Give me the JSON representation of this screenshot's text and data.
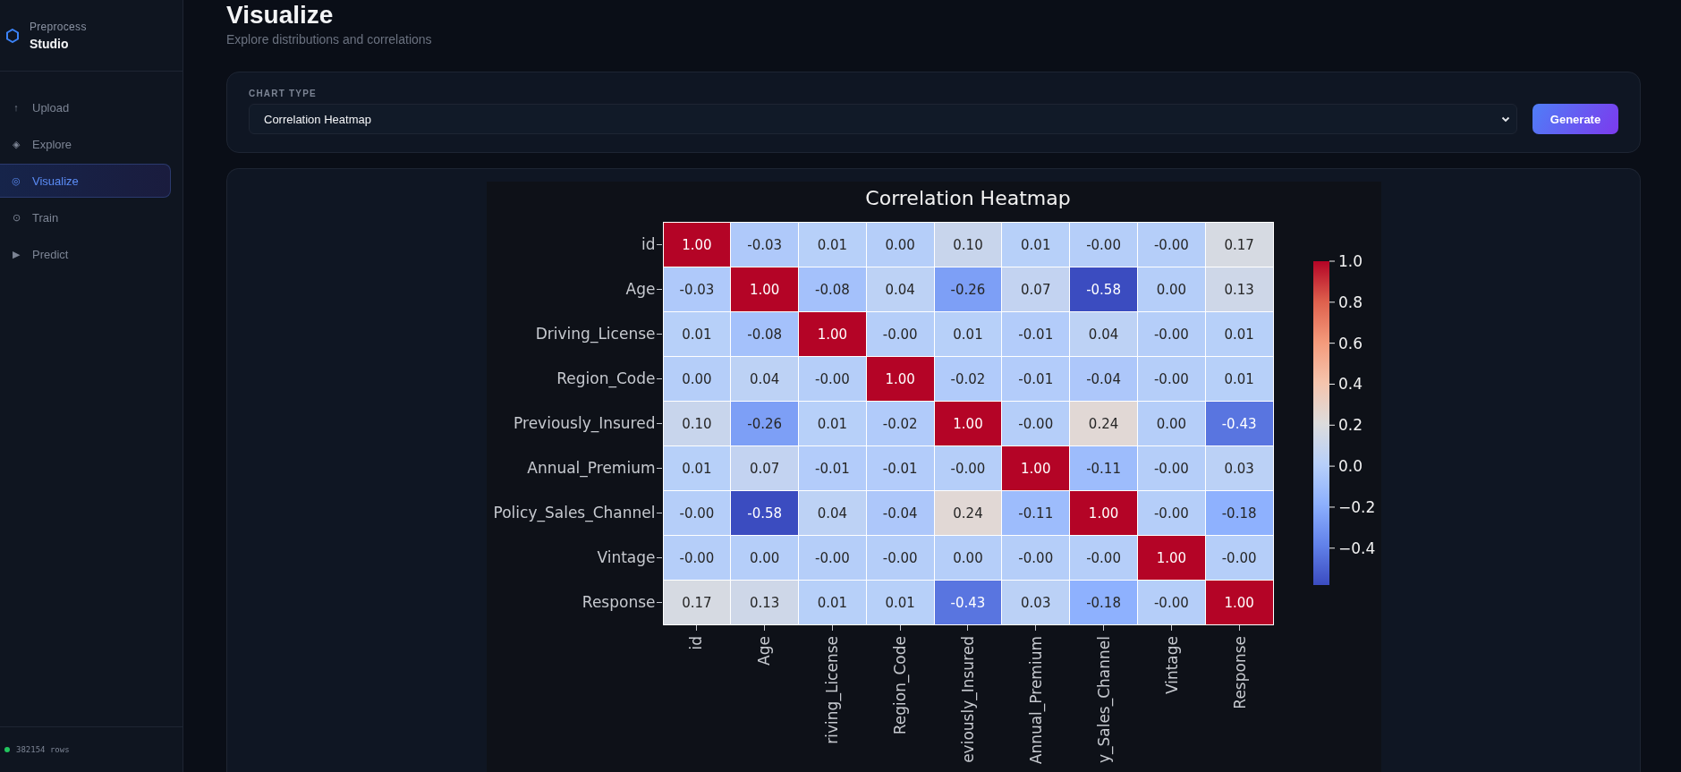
{
  "sidebar": {
    "brand": {
      "top": "Preprocess",
      "name": "Studio"
    },
    "items": [
      {
        "icon": "↑",
        "label": "Upload",
        "selected": false
      },
      {
        "icon": "◈",
        "label": "Explore",
        "selected": false
      },
      {
        "icon": "◎",
        "label": "Visualize",
        "selected": true
      },
      {
        "icon": "⊙",
        "label": "Train",
        "selected": false
      },
      {
        "icon": "▶",
        "label": "Predict",
        "selected": false
      }
    ],
    "status": {
      "text": "382154 rows",
      "color": "#22c55e"
    }
  },
  "header": {
    "title": "Visualize",
    "subtitle": "Explore distributions and correlations"
  },
  "controls": {
    "label": "CHART TYPE",
    "value": "Correlation Heatmap",
    "button": "Generate"
  },
  "heatmap": {
    "title": "Correlation Heatmap",
    "row_labels": [
      "id",
      "Age",
      "Driving_License",
      "Region_Code",
      "Previously_Insured",
      "Annual_Premium",
      "Policy_Sales_Channel",
      "Vintage",
      "Response"
    ],
    "column_labels": [
      "id",
      "Age",
      "riving_License",
      "Region_Code",
      "eviously_Insured",
      "Annual_Premium",
      "y_Sales_Channel",
      "Vintage",
      "Response"
    ],
    "rows": [
      [
        "1.00",
        "-0.03",
        "0.01",
        "0.00",
        "0.10",
        "0.01",
        "-0.00",
        "-0.00",
        "0.17"
      ],
      [
        "-0.03",
        "1.00",
        "-0.08",
        "0.04",
        "-0.26",
        "0.07",
        "-0.58",
        "0.00",
        "0.13"
      ],
      [
        "0.01",
        "-0.08",
        "1.00",
        "-0.00",
        "0.01",
        "-0.01",
        "0.04",
        "-0.00",
        "0.01"
      ],
      [
        "0.00",
        "0.04",
        "-0.00",
        "1.00",
        "-0.02",
        "-0.01",
        "-0.04",
        "-0.00",
        "0.01"
      ],
      [
        "0.10",
        "-0.26",
        "0.01",
        "-0.02",
        "1.00",
        "-0.00",
        "0.24",
        "0.00",
        "-0.43"
      ],
      [
        "0.01",
        "0.07",
        "-0.01",
        "-0.01",
        "-0.00",
        "1.00",
        "-0.11",
        "-0.00",
        "0.03"
      ],
      [
        "-0.00",
        "-0.58",
        "0.04",
        "-0.04",
        "0.24",
        "-0.11",
        "1.00",
        "-0.00",
        "-0.18"
      ],
      [
        "-0.00",
        "0.00",
        "-0.00",
        "-0.00",
        "0.00",
        "-0.00",
        "-0.00",
        "1.00",
        "-0.00"
      ],
      [
        "0.17",
        "0.13",
        "0.01",
        "0.01",
        "-0.43",
        "0.03",
        "-0.18",
        "-0.00",
        "1.00"
      ]
    ],
    "colorbar_ticks": [
      "1.0",
      "0.8",
      "0.6",
      "0.4",
      "0.2",
      "0.0",
      "−0.2",
      "−0.4"
    ]
  }
}
